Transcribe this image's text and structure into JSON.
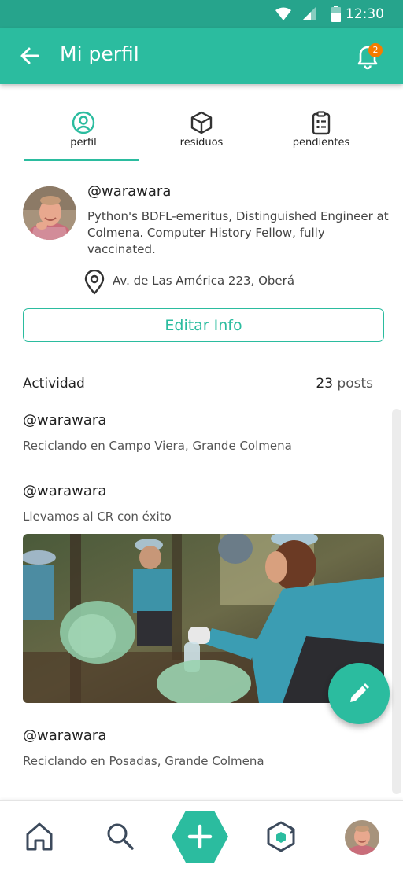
{
  "status_bar": {
    "time": "12:30"
  },
  "app_bar": {
    "title": "Mi perfil",
    "notification_count": "2"
  },
  "tabs": [
    {
      "label": "perfil",
      "icon": "user-circle-icon",
      "active": true
    },
    {
      "label": "residuos",
      "icon": "box-icon",
      "active": false
    },
    {
      "label": "pendientes",
      "icon": "clipboard-list-icon",
      "active": false
    }
  ],
  "profile": {
    "username": "@warawara",
    "bio": "Python's BDFL-emeritus, Distinguished Engineer at Colmena. Computer History Fellow, fully vaccinated.",
    "location": "Av. de Las América 223, Oberá",
    "edit_label": "Editar Info"
  },
  "activity": {
    "title": "Actividad",
    "count": "23",
    "count_unit": "posts",
    "posts": [
      {
        "user": "@warawara",
        "text": "Reciclando en Campo Viera, Grande Colmena"
      },
      {
        "user": "@warawara",
        "text": "Llevamos al CR con éxito"
      },
      {
        "user": "@warawara",
        "text": "Reciclando en Posadas, Grande Colmena"
      }
    ]
  },
  "colors": {
    "primary": "#2bbc9f",
    "status_bar": "#26a48c",
    "badge": "#f57c00"
  },
  "bottom_nav": [
    "home-icon",
    "search-icon",
    "add-icon",
    "recycle-icon",
    "profile-avatar"
  ]
}
